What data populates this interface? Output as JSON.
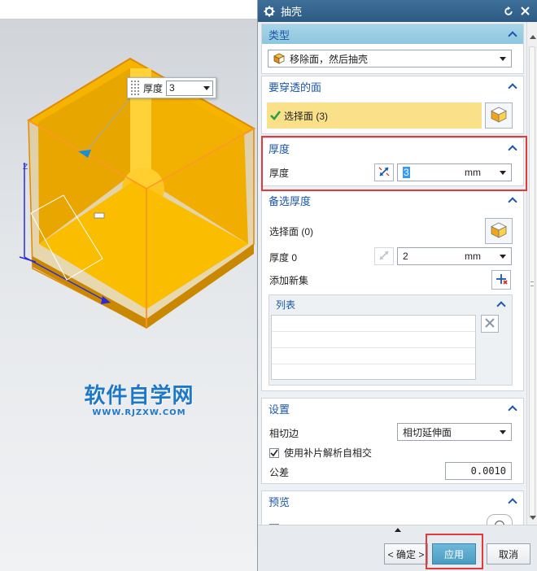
{
  "viewport": {
    "floating_label": "厚度",
    "floating_value": "3",
    "watermark_title": "软件自学网",
    "watermark_url": "WWW.RJZXW.COM"
  },
  "dialog": {
    "title": "抽壳",
    "sections": {
      "type": {
        "title": "类型",
        "selected_option": "移除面，然后抽壳"
      },
      "faces_to_pierce": {
        "title": "要穿透的面",
        "select_label": "选择面 (3)"
      },
      "thickness": {
        "title": "厚度",
        "label": "厚度",
        "value": "3",
        "unit": "mm"
      },
      "alternate_thickness": {
        "title": "备选厚度",
        "select_face_label": "选择面 (0)",
        "thickness_label": "厚度 0",
        "thickness_value": "2",
        "unit": "mm",
        "add_set_label": "添加新集",
        "list_title": "列表"
      },
      "settings": {
        "title": "设置",
        "tangent_edge_label": "相切边",
        "tangent_edge_value": "相切延伸面",
        "patch_checkbox_label": "使用补片解析自相交",
        "patch_checked": true,
        "tolerance_label": "公差",
        "tolerance_value": "0.0010"
      },
      "preview": {
        "title": "预览"
      }
    },
    "buttons": {
      "ok": "< 确定 >",
      "apply": "应用",
      "cancel": "取消"
    }
  },
  "colors": {
    "title_bar": "#2c5a83",
    "section_header_active": "#8cc6de",
    "section_title_text": "#1b57a8",
    "selection_highlight": "#fbe08a",
    "highlight_box": "#e23a3a",
    "part_orange": "#ffc200",
    "watermark": "#1e78c8"
  }
}
